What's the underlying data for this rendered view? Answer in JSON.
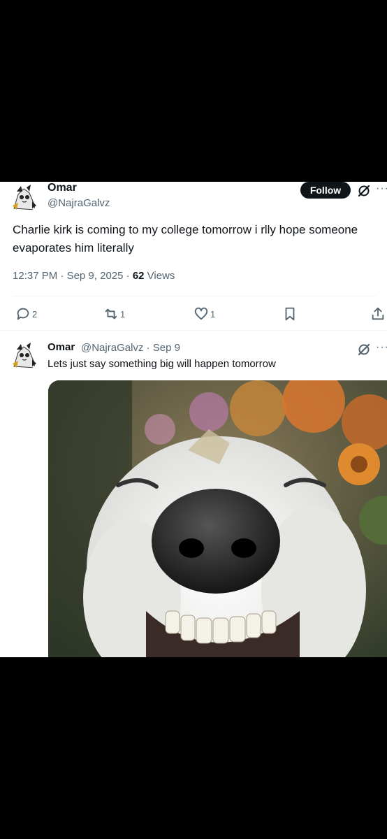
{
  "tweet": {
    "author_name": "Omar",
    "author_handle": "@NajraGalvz",
    "follow_label": "Follow",
    "text": "Charlie kirk is coming to my college tomorrow i rlly hope someone evaporates him literally",
    "time": "12:37 PM",
    "date": "Sep 9, 2025",
    "views_count": "62",
    "views_label": "Views",
    "replies": "2",
    "reposts": "1",
    "likes": "1"
  },
  "reply": {
    "author_name": "Omar",
    "author_handle": "@NajraGalvz",
    "date": "Sep 9",
    "text": "Lets just say something big will happen tomorrow",
    "media": "smiling-dog-image"
  },
  "icons": {
    "avatar": "anime-character-avatar",
    "grok": "grok-icon",
    "more": "more-horizontal-icon",
    "reply": "reply-bubble-icon",
    "repost": "repost-icon",
    "like": "heart-icon",
    "bookmark": "bookmark-icon",
    "share": "share-icon"
  },
  "colors": {
    "text_primary": "#0f1419",
    "text_secondary": "#536471",
    "follow_bg": "#0f1419",
    "divider": "#eff3f4"
  }
}
